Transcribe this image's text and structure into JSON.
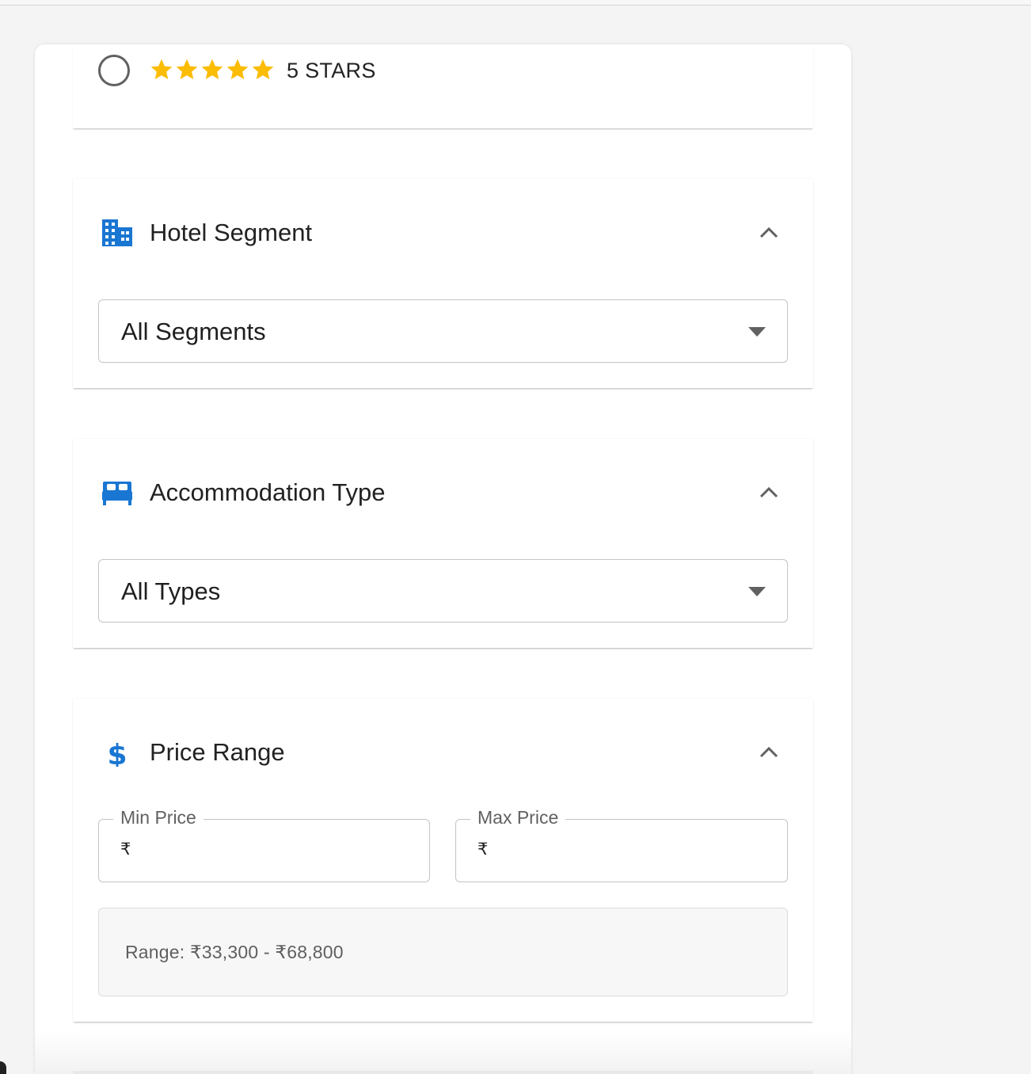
{
  "rating": {
    "stars": 5,
    "label": "5 STARS",
    "star_color": "#fbbc04",
    "radio_selected": false
  },
  "hotel_segment": {
    "title": "Hotel Segment",
    "icon": "building-icon",
    "select_value": "All Segments",
    "expanded": true
  },
  "accommodation_type": {
    "title": "Accommodation Type",
    "icon": "bed-icon",
    "select_value": "All Types",
    "expanded": true
  },
  "price_range": {
    "title": "Price Range",
    "icon": "dollar-icon",
    "expanded": true,
    "min_label": "Min Price",
    "max_label": "Max Price",
    "currency_symbol": "₹",
    "min_value": "",
    "max_value": "",
    "range_text": "Range: ₹33,300 - ₹68,800"
  },
  "colors": {
    "accent": "#1976d2",
    "chevron": "#616161",
    "border": "#c4c4c4"
  }
}
